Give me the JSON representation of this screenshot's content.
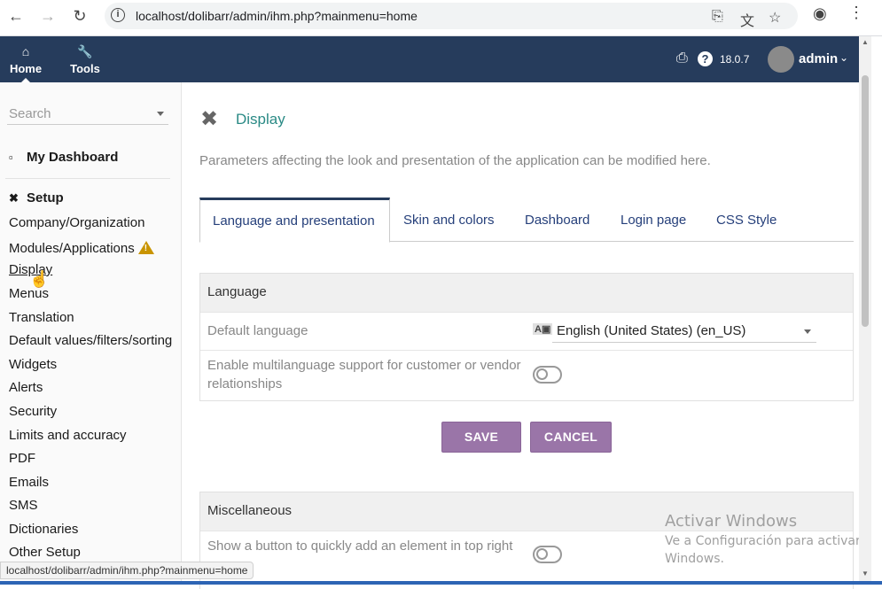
{
  "browser": {
    "url": "localhost/dolibarr/admin/ihm.php?mainmenu=home",
    "status_url": "localhost/dolibarr/admin/ihm.php?mainmenu=home"
  },
  "topbar": {
    "home_label": "Home",
    "tools_label": "Tools",
    "version": "18.0.7",
    "user": "admin"
  },
  "sidebar": {
    "search_placeholder": "Search",
    "dashboard_label": "My Dashboard",
    "setup_label": "Setup",
    "items": [
      {
        "label": "Company/Organization"
      },
      {
        "label": "Modules/Applications"
      },
      {
        "label": "Display"
      },
      {
        "label": "Menus"
      },
      {
        "label": "Translation"
      },
      {
        "label": "Default values/filters/sorting"
      },
      {
        "label": "Widgets"
      },
      {
        "label": "Alerts"
      },
      {
        "label": "Security"
      },
      {
        "label": "Limits and accuracy"
      },
      {
        "label": "PDF"
      },
      {
        "label": "Emails"
      },
      {
        "label": "SMS"
      },
      {
        "label": "Dictionaries"
      },
      {
        "label": "Other Setup"
      }
    ]
  },
  "page": {
    "title": "Display",
    "description": "Parameters affecting the look and presentation of the application can be modified here.",
    "tabs": [
      {
        "label": "Language and presentation"
      },
      {
        "label": "Skin and colors"
      },
      {
        "label": "Dashboard"
      },
      {
        "label": "Login page"
      },
      {
        "label": "CSS Style"
      }
    ]
  },
  "language_section": {
    "header": "Language",
    "default_language_label": "Default language",
    "default_language_value": "English (United States) (en_US)",
    "multilang_label_1": "Enable multilanguage support for customer or vendor",
    "multilang_label_2": "relationships"
  },
  "buttons": {
    "save": "SAVE",
    "cancel": "CANCEL"
  },
  "misc_section": {
    "header": "Miscellaneous",
    "quick_add_label": "Show a button to quickly add an element in top right"
  },
  "watermark": {
    "line1": "Activar Windows",
    "line2": "Ve a Configuración para activar",
    "line3": "Windows."
  }
}
